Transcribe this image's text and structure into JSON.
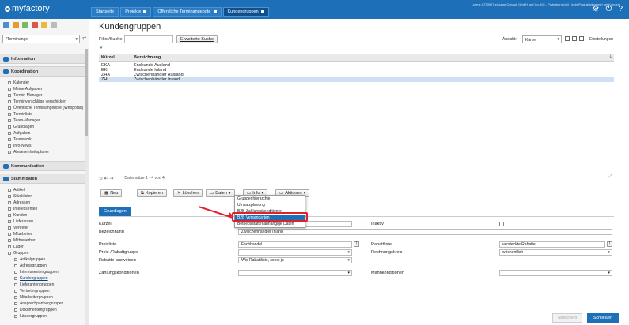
{
  "app": {
    "logo_text": "myfactory",
    "license_text": "Lizenz A730927 eiscape Consult GmbH und Co. KG - Paderborn(ost) - kein Produktivkontext] bei Kunden"
  },
  "tabs": [
    {
      "label": "Startseite",
      "active": false
    },
    {
      "label": "Projekte",
      "active": false
    },
    {
      "label": "Öffentliche Terminangebote",
      "active": false
    },
    {
      "label": "Kundengruppen",
      "active": true
    }
  ],
  "sidebar": {
    "dropdown_value": "*Terminange",
    "sections": {
      "information": "Information",
      "koordination": "Koordination",
      "kommunikation": "Kommunikation",
      "stammdaten": "Stammdaten"
    },
    "koordination_items": [
      "Kalender",
      "Meine Aufgaben",
      "Termin-Manager",
      "Terminvorschläge verschicken",
      "Öffentliche Terminangebote (Webportal)",
      "Terminliste",
      "Team-Manager",
      "Grundlagen",
      "Aufgaben",
      "Teamwork",
      "Info-News",
      "Abwesenheitsplaner"
    ],
    "stammdaten_items": [
      "Artikel",
      "Stücklisten",
      "Adressen",
      "Interessenten",
      "Kunden",
      "Lieferanten",
      "Vertreter",
      "Mitarbeiter",
      "Mitbewerber",
      "Lager",
      "Gruppen"
    ],
    "gruppen_items": [
      "Artikelgruppen",
      "Adressgruppen",
      "Interessentengruppen",
      "Kundengruppen",
      "Lieferantengruppen",
      "Vertretergruppen",
      "Mitarbeitergruppen",
      "Ansprechpartnergruppen",
      "Dokumentengruppen",
      "Ländergruppen"
    ],
    "selected_item": "Kundengruppen"
  },
  "main": {
    "title": "Kundengruppen",
    "filter_label": "Filter/Suche:",
    "filter_value": "",
    "advanced_search_label": "Erweiterte Suche",
    "ansicht_label": "Ansicht:",
    "ansicht_value": "Kürzel",
    "settings_label": "Einstellungen",
    "table": {
      "headers": [
        "Kürzel",
        "Bezeichnung"
      ],
      "rows": [
        [
          "EKA",
          "Endkunde Ausland"
        ],
        [
          "EKI",
          "Endkunde Inland"
        ],
        [
          "ZHA",
          "Zwischenhändler Ausland"
        ],
        [
          "ZHI",
          "Zwischenhändler Inland"
        ]
      ],
      "selected_row": 3,
      "record_info": "Datensätze 1 - 4 von 4"
    },
    "toolbar": {
      "new": "Neu",
      "copy": "Kopieren",
      "delete": "Löschen",
      "data": "Daten",
      "info": "Info",
      "actions": "Aktionen"
    },
    "info_menu": {
      "items": [
        "Gruppenhierarchie",
        "Umsatzplanung",
        "B2B Zahlungskonditionen",
        "B2B Versandarten",
        "Betriebsstättenabhängige Daten"
      ],
      "highlighted": 3
    },
    "form": {
      "tab_label": "Grundlagen",
      "kuerzel_label": "Kürzel",
      "kuerzel_value": "",
      "inaktiv_label": "Inaktiv",
      "bezeichnung_label": "Bezeichnung",
      "bezeichnung_value": "Zwischenhändler Inland",
      "preisliste_label": "Preisliste",
      "preisliste_value": "Fachhandel",
      "rabattliste_label": "Rabattliste",
      "rabattliste_value": "versteckte Rabatte",
      "preis_rabattgruppe_label": "Preis-/Rabattgruppe",
      "preis_rabattgruppe_value": "",
      "rechnungskreis_label": "Rechnungskreis",
      "rechnungskreis_value": "wöchentlich",
      "rabatte_label": "Rabatte ausweisen",
      "rabatte_value": "Wie Rabattliste, sonst ja",
      "zahlungskonditionen_label": "Zahlungskonditionen",
      "zahlungskonditionen_value": "",
      "mahnkonditionen_label": "Mahnkonditionen",
      "mahnkonditionen_value": ""
    },
    "save_label": "Speichern",
    "close_label": "Schließen"
  },
  "colors": {
    "brand_blue": "#1d6fb8",
    "highlight_red": "#e0202a"
  }
}
